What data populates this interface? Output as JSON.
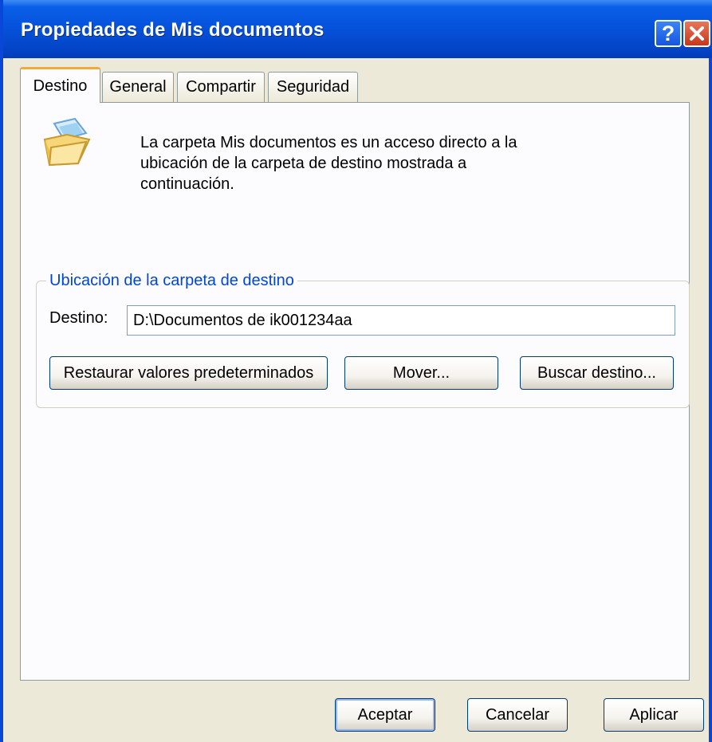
{
  "window": {
    "title": "Propiedades de Mis documentos"
  },
  "tabs": [
    {
      "label": "Destino",
      "active": true
    },
    {
      "label": "General"
    },
    {
      "label": "Compartir"
    },
    {
      "label": "Seguridad"
    }
  ],
  "description": {
    "line1": "La carpeta Mis documentos es un acceso directo a la",
    "line2": "ubicación de la carpeta de destino mostrada a",
    "line3": "continuación."
  },
  "group": {
    "label": "Ubicación de la carpeta de destino",
    "field_label": "Destino:",
    "field_value": "D:\\Documentos de ik001234aa",
    "restore_button": "Restaurar valores predeterminados",
    "move_button": "Mover...",
    "find_button": "Buscar destino..."
  },
  "footer": {
    "ok": "Aceptar",
    "cancel": "Cancelar",
    "apply": "Aplicar"
  },
  "icons": {
    "help": "help-icon",
    "close": "close-icon",
    "folder": "open-folder-icon"
  },
  "colors": {
    "title_bar": "#0553de",
    "accent_text": "#0046d5",
    "active_tab": "#f0a93b",
    "dialog_bg": "#ece9d8"
  }
}
